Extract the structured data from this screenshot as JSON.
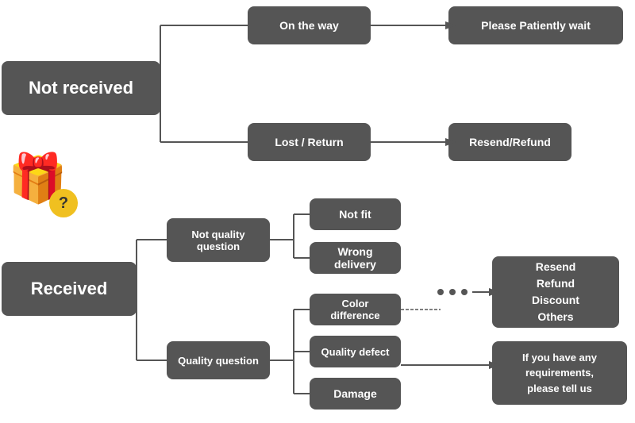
{
  "nodes": {
    "not_received": {
      "label": "Not received"
    },
    "on_the_way": {
      "label": "On the way"
    },
    "please_wait": {
      "label": "Please Patiently wait"
    },
    "lost_return": {
      "label": "Lost / Return"
    },
    "resend_refund_top": {
      "label": "Resend/Refund"
    },
    "received": {
      "label": "Received"
    },
    "not_quality_question": {
      "label": "Not quality\nquestion"
    },
    "quality_question": {
      "label": "Quality question"
    },
    "not_fit": {
      "label": "Not fit"
    },
    "wrong_delivery": {
      "label": "Wrong delivery"
    },
    "color_difference": {
      "label": "Color difference"
    },
    "quality_defect": {
      "label": "Quality defect"
    },
    "damage": {
      "label": "Damage"
    },
    "resend_refund_box": {
      "label": "Resend\nRefund\nDiscount\nOthers"
    },
    "if_you_have": {
      "label": "If you have any\nrequirements,\nplease tell us"
    }
  }
}
